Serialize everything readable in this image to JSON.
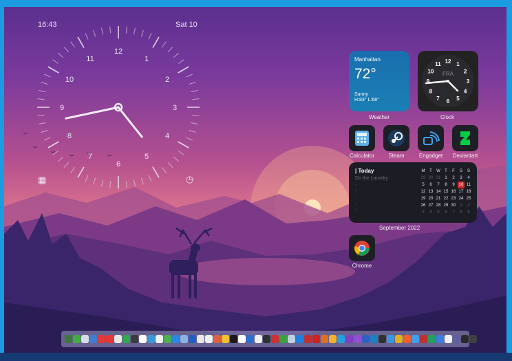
{
  "status": {
    "time": "16:43",
    "date": "Sat 10"
  },
  "analog_clock": {
    "numerals": [
      "12",
      "1",
      "2",
      "3",
      "4",
      "5",
      "6",
      "7",
      "8",
      "9",
      "10",
      "11"
    ],
    "hour": 4,
    "minute": 43
  },
  "weather": {
    "city": "Manhattan",
    "temperature": "72°",
    "condition": "Sunny",
    "high_low": "H:83° L:68°",
    "caption": "Weather"
  },
  "clock_widget": {
    "city_code": "FRA",
    "caption": "Clock",
    "numerals": [
      "12",
      "1",
      "2",
      "3",
      "4",
      "5",
      "6",
      "7",
      "8",
      "9",
      "10",
      "11"
    ]
  },
  "apps": [
    {
      "label": "Calculator",
      "icon": "calculator-icon"
    },
    {
      "label": "Steam",
      "icon": "steam-icon"
    },
    {
      "label": "Engadget",
      "icon": "engadget-icon"
    },
    {
      "label": "Deviantart",
      "icon": "deviantart-icon"
    }
  ],
  "calendar": {
    "today_label": "| Today",
    "task": "Do the Laundry",
    "weekdays": [
      "M",
      "T",
      "W",
      "T",
      "F",
      "S",
      "S"
    ],
    "weeks": [
      [
        "29",
        "30",
        "31",
        "1",
        "2",
        "3",
        "4"
      ],
      [
        "5",
        "6",
        "7",
        "8",
        "9",
        "10",
        "11"
      ],
      [
        "12",
        "13",
        "14",
        "15",
        "16",
        "17",
        "18"
      ],
      [
        "19",
        "20",
        "21",
        "22",
        "23",
        "24",
        "25"
      ],
      [
        "26",
        "27",
        "28",
        "29",
        "30",
        "1",
        "2"
      ],
      [
        "3",
        "4",
        "5",
        "6",
        "7",
        "8",
        "9"
      ]
    ],
    "highlight": "10",
    "caption": "September 2022"
  },
  "chrome": {
    "label": "Chrome",
    "icon": "chrome-icon"
  },
  "colors": {
    "accent_frame": "#1b9ce0",
    "weather_bg": "#1a6fae",
    "today_highlight": "#d12b2b"
  },
  "dock": {
    "icon_colors": [
      "#3b7a3b",
      "#3fae3f",
      "#d7dce6",
      "#3f7fd0",
      "#e03a3a",
      "#e03a3a",
      "#e8e8e8",
      "#2fa84a",
      "#3b3b3b",
      "#ffffff",
      "#3a9ad9",
      "#f0f0f0",
      "#4caf50",
      "#2a88e0",
      "#8fb0e0",
      "#2060c0",
      "#e8e8e8",
      "#f0f0f0",
      "#e06040",
      "#f0c030",
      "#1a1a1a",
      "#ffffff",
      "#2a70d0",
      "#f0f0f0",
      "#303030",
      "#d03030",
      "#3aa040",
      "#c0d0e0",
      "#2080e0",
      "#c03030",
      "#d02020",
      "#e07020",
      "#f0b030",
      "#20a0e0",
      "#8040c0",
      "#9050d0",
      "#3060c0",
      "#1a80c0",
      "#303030",
      "#3a9ad9",
      "#e0b020",
      "#f06030",
      "#40a0f0",
      "#c03030",
      "#20a060",
      "#3a80e0",
      "#f0f0f0",
      "#6060a0",
      "#2a2a2a",
      "#404040"
    ]
  }
}
